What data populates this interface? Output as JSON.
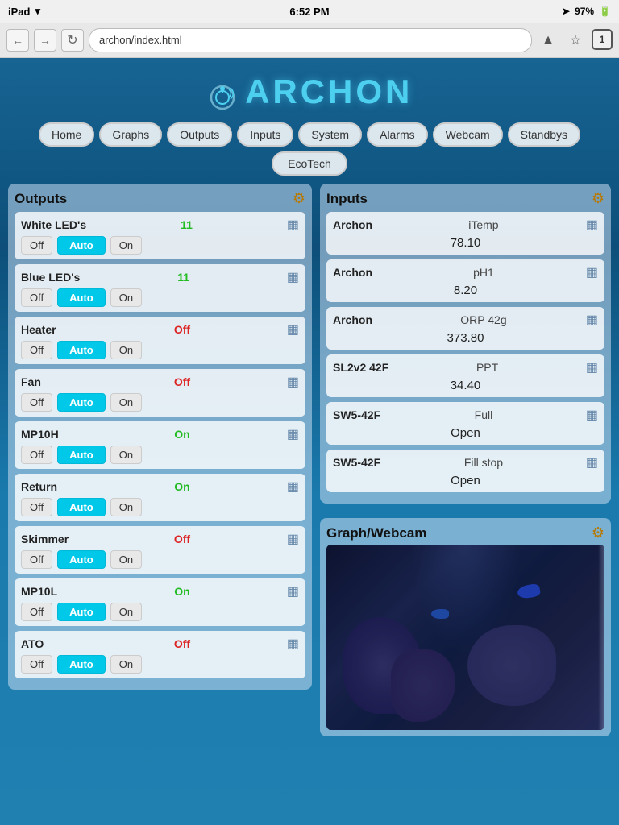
{
  "statusBar": {
    "carrier": "iPad",
    "wifi": "wifi",
    "time": "6:52 PM",
    "location": "arrow",
    "signal": "signal",
    "battery": "97%"
  },
  "browser": {
    "url": "archon/index.html",
    "tabCount": "1"
  },
  "logo": {
    "text": "ARCHON"
  },
  "nav": {
    "items": [
      "Home",
      "Graphs",
      "Outputs",
      "Inputs",
      "System",
      "Alarms",
      "Webcam",
      "Standbys"
    ],
    "second": [
      "EcoTech"
    ]
  },
  "outputs": {
    "title": "Outputs",
    "items": [
      {
        "name": "White LED's",
        "status": "11",
        "statusClass": "green",
        "controls": [
          "Off",
          "Auto",
          "On"
        ]
      },
      {
        "name": "Blue LED's",
        "status": "11",
        "statusClass": "green",
        "controls": [
          "Off",
          "Auto",
          "On"
        ]
      },
      {
        "name": "Heater",
        "status": "Off",
        "statusClass": "red",
        "controls": [
          "Off",
          "Auto",
          "On"
        ]
      },
      {
        "name": "Fan",
        "status": "Off",
        "statusClass": "red",
        "controls": [
          "Off",
          "Auto",
          "On"
        ]
      },
      {
        "name": "MP10H",
        "status": "On",
        "statusClass": "green",
        "controls": [
          "Off",
          "Auto",
          "On"
        ]
      },
      {
        "name": "Return",
        "status": "On",
        "statusClass": "green",
        "controls": [
          "Off",
          "Auto",
          "On"
        ]
      },
      {
        "name": "Skimmer",
        "status": "Off",
        "statusClass": "red",
        "controls": [
          "Off",
          "Auto",
          "On"
        ]
      },
      {
        "name": "MP10L",
        "status": "On",
        "statusClass": "green",
        "controls": [
          "Off",
          "Auto",
          "On"
        ]
      },
      {
        "name": "ATO",
        "status": "Off",
        "statusClass": "red",
        "controls": [
          "Off",
          "Auto",
          "On"
        ]
      }
    ]
  },
  "inputs": {
    "title": "Inputs",
    "items": [
      {
        "source": "Archon",
        "name": "iTemp",
        "value": "78.10"
      },
      {
        "source": "Archon",
        "name": "pH1",
        "value": "8.20"
      },
      {
        "source": "Archon",
        "name": "ORP 42g",
        "value": "373.80"
      },
      {
        "source": "SL2v2 42F",
        "name": "PPT",
        "value": "34.40"
      },
      {
        "source": "SW5-42F",
        "name": "Full",
        "value": "Open"
      },
      {
        "source": "SW5-42F",
        "name": "Fill stop",
        "value": "Open"
      }
    ]
  },
  "graphWebcam": {
    "title": "Graph/Webcam"
  }
}
